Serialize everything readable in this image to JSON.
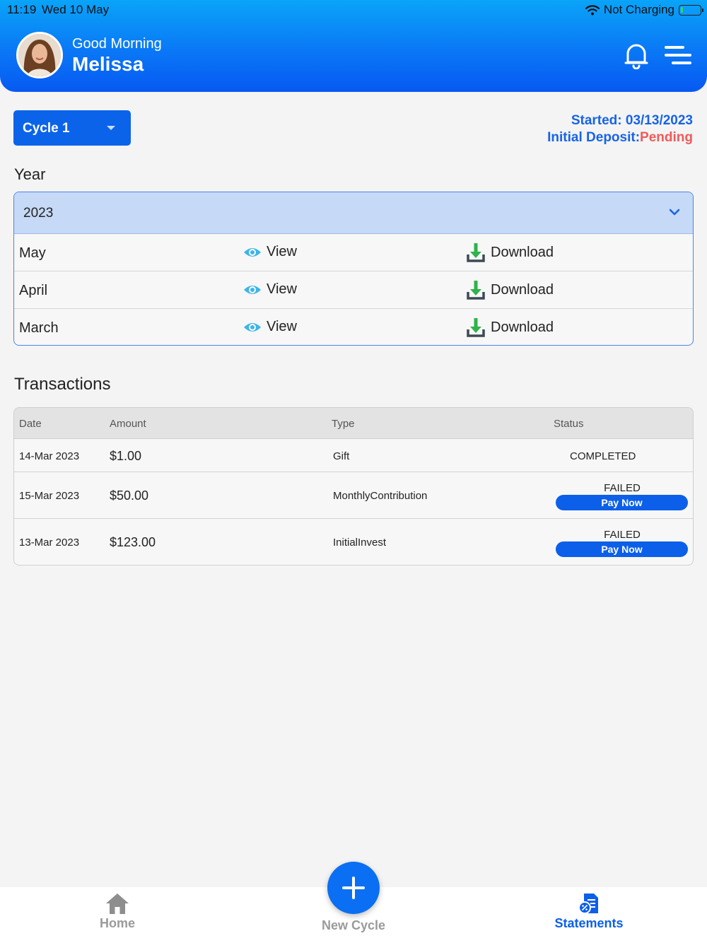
{
  "status_bar": {
    "time": "11:19",
    "date": "Wed 10 May",
    "charging": "Not Charging"
  },
  "header": {
    "greeting": "Good Morning",
    "user_name": "Melissa"
  },
  "cycle": {
    "selected": "Cycle 1",
    "started": "Started: 03/13/2023",
    "deposit_label": "Initial Deposit:",
    "deposit_status": "Pending"
  },
  "statements": {
    "year_label": "Year",
    "year": "2023",
    "view_label": "View",
    "download_label": "Download",
    "months": [
      "May",
      "April",
      "March"
    ]
  },
  "transactions": {
    "title": "Transactions",
    "columns": [
      "Date",
      "Amount",
      "Type",
      "Status"
    ],
    "rows": [
      {
        "date": "14-Mar 2023",
        "amount": "$1.00",
        "type": "Gift",
        "status": "COMPLETED",
        "action": ""
      },
      {
        "date": "15-Mar 2023",
        "amount": "$50.00",
        "type": "MonthlyContribution",
        "status": "FAILED",
        "action": "Pay Now"
      },
      {
        "date": "13-Mar 2023",
        "amount": "$123.00",
        "type": "InitialInvest",
        "status": "FAILED",
        "action": "Pay Now"
      }
    ]
  },
  "tabs": {
    "home": "Home",
    "new_cycle": "New Cycle",
    "statements": "Statements"
  },
  "colors": {
    "primary": "#0b63ea",
    "pending": "#f05a5a",
    "active_tab": "#0b5fe8",
    "inactive_tab": "#9a9a9a"
  }
}
